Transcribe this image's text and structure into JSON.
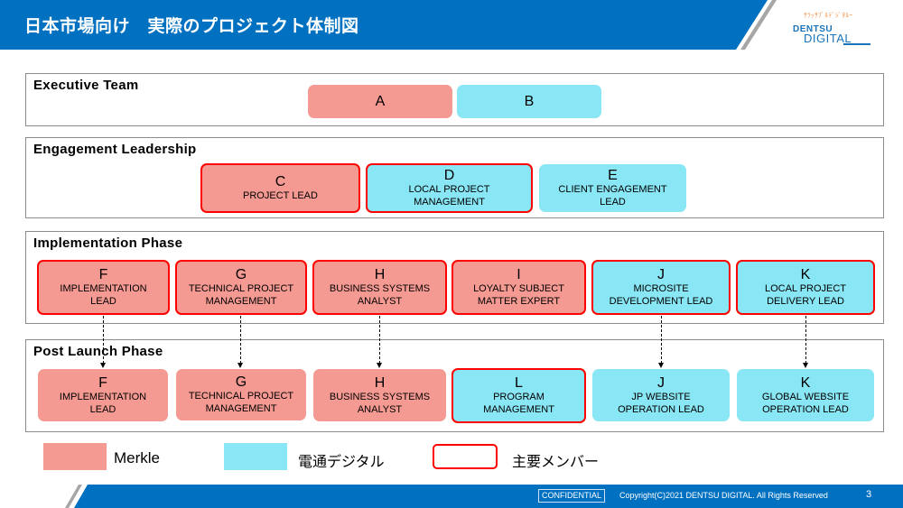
{
  "header": {
    "title": "日本市場向け　実際のプロジェクト体制図",
    "logo": {
      "tagline": "ｻﾗｯｻﾌﾞﾙﾃﾞｼﾞﾀﾙｰ",
      "line1": "DENTSU",
      "line2": "DIGITAL"
    },
    "accent_color": "#0070c0"
  },
  "colors": {
    "merkle": "#f59a92",
    "dentsu_digital": "#89e6f4",
    "key_member_border": "#ff0000"
  },
  "panels": {
    "executive": {
      "title": "Executive Team",
      "boxes": [
        {
          "letter": "A",
          "role": "",
          "org": "merkle",
          "key": false
        },
        {
          "letter": "B",
          "role": "",
          "org": "dentsu",
          "key": false
        }
      ]
    },
    "engagement": {
      "title": "Engagement Leadership",
      "boxes": [
        {
          "letter": "C",
          "role": "PROJECT LEAD",
          "org": "merkle",
          "key": true
        },
        {
          "letter": "D",
          "role": "LOCAL PROJECT MANAGEMENT",
          "org": "dentsu",
          "key": true
        },
        {
          "letter": "E",
          "role": "CLIENT ENGAGEMENT LEAD",
          "org": "dentsu",
          "key": false
        }
      ]
    },
    "implementation": {
      "title": "Implementation Phase",
      "boxes": [
        {
          "letter": "F",
          "role": "IMPLEMENTATION LEAD",
          "org": "merkle",
          "key": true
        },
        {
          "letter": "G",
          "role": "TECHNICAL PROJECT MANAGEMENT",
          "org": "merkle",
          "key": true
        },
        {
          "letter": "H",
          "role": "BUSINESS SYSTEMS ANALYST",
          "org": "merkle",
          "key": true
        },
        {
          "letter": "I",
          "role": "LOYALTY SUBJECT MATTER EXPERT",
          "org": "merkle",
          "key": true
        },
        {
          "letter": "J",
          "role": "MICROSITE DEVELOPMENT LEAD",
          "org": "dentsu",
          "key": true
        },
        {
          "letter": "K",
          "role": "LOCAL PROJECT DELIVERY LEAD",
          "org": "dentsu",
          "key": true
        }
      ]
    },
    "post_launch": {
      "title": "Post Launch Phase",
      "boxes": [
        {
          "letter": "F",
          "role": "IMPLEMENTATION LEAD",
          "org": "merkle",
          "key": false
        },
        {
          "letter": "G",
          "role": "TECHNICAL PROJECT MANAGEMENT",
          "org": "merkle",
          "key": false
        },
        {
          "letter": "H",
          "role": "BUSINESS SYSTEMS ANALYST",
          "org": "merkle",
          "key": false
        },
        {
          "letter": "L",
          "role": "PROGRAM MANAGEMENT",
          "org": "dentsu",
          "key": true
        },
        {
          "letter": "J",
          "role": "JP WEBSITE OPERATION LEAD",
          "org": "dentsu",
          "key": false
        },
        {
          "letter": "K",
          "role": "GLOBAL WEBSITE OPERATION LEAD",
          "org": "dentsu",
          "key": false
        }
      ]
    }
  },
  "transitions": [
    {
      "from": "implementation.F",
      "to": "post_launch.F"
    },
    {
      "from": "implementation.G",
      "to": "post_launch.G"
    },
    {
      "from": "implementation.H",
      "to": "post_launch.H"
    },
    {
      "from": "implementation.J",
      "to": "post_launch.J"
    },
    {
      "from": "implementation.K",
      "to": "post_launch.K"
    }
  ],
  "legend": {
    "merkle": "Merkle",
    "dentsu": "電通デジタル",
    "key": "主要メンバー"
  },
  "footer": {
    "confidential": "CONFIDENTIAL",
    "copyright": "Copyright(C)2021 DENTSU DIGITAL. All Rights Reserved",
    "page_number": "3"
  }
}
